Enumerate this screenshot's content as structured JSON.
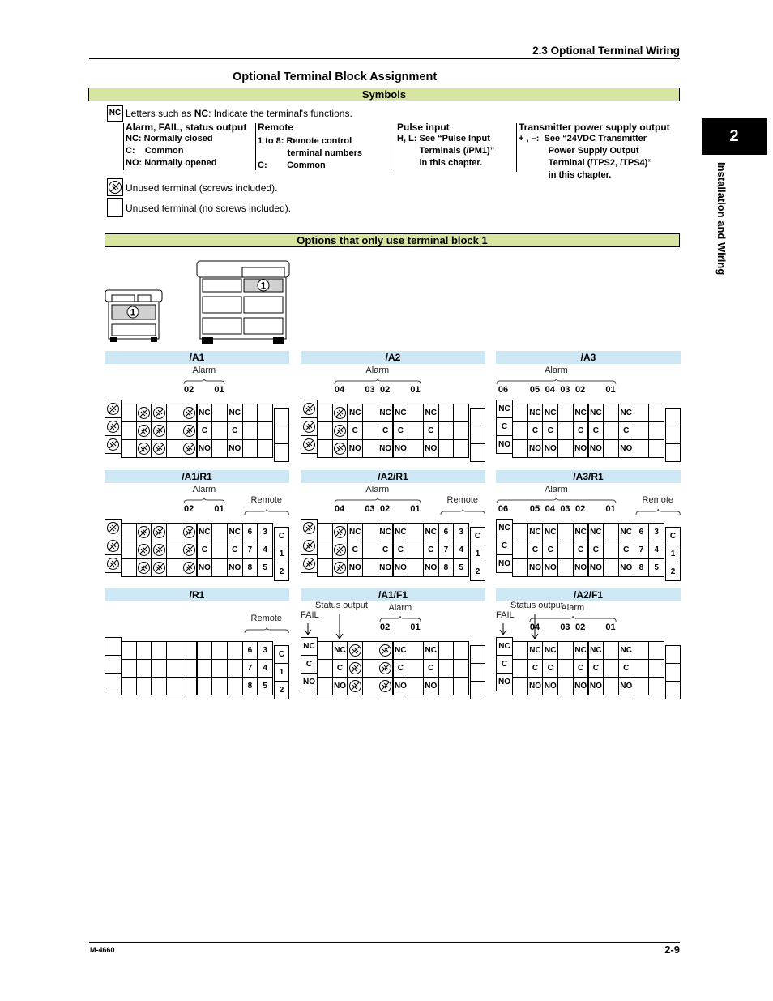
{
  "header": {
    "section_title": "2.3  Optional Terminal Wiring"
  },
  "page_title": "Optional Terminal Block Assignment",
  "symbols": {
    "bar_label": "Symbols",
    "nc_box": "NC",
    "nc_desc_pre": "Letters such as ",
    "nc_desc_bold": "NC",
    "nc_desc_post": ": Indicate the terminal's functions.",
    "legend": [
      {
        "heading": "Alarm, FAIL, status output",
        "lines": [
          "NC: Normally closed",
          "C:    Common",
          "NO: Normally opened"
        ]
      },
      {
        "heading": "Remote",
        "lines": [
          "1 to 8: Remote control",
          "            terminal numbers",
          "C:        Common"
        ]
      },
      {
        "heading": "Pulse input",
        "lines": [
          "H, L: See “Pulse Input",
          "         Terminals (/PM1)”",
          "         in this chapter."
        ]
      },
      {
        "heading": "Transmitter power supply output",
        "lines": [
          "+ , –:  See “24VDC Transmitter",
          "            Power Supply Output",
          "            Terminal (/TPS2, /TPS4)”",
          "            in this chapter."
        ]
      }
    ],
    "unused_screw": "Unused terminal (screws included).",
    "unused_noscrew": "Unused terminal (no screws included)."
  },
  "options_bar": "Options that only use terminal block 1",
  "device_marker": "1",
  "chapter": {
    "number": "2",
    "title": "Installation and Wiring"
  },
  "blocks": [
    {
      "title": "/A1",
      "groups": [
        {
          "label": "Alarm",
          "from": 5,
          "to": 7
        }
      ],
      "numbers": [
        {
          "col": 5,
          "text": "02"
        },
        {
          "col": 7,
          "text": "01"
        }
      ],
      "left": [
        "S",
        "S",
        "S"
      ],
      "main": [
        [
          "",
          "S",
          "S",
          "",
          "S",
          "NC",
          "",
          "NC",
          "",
          ""
        ],
        [
          "",
          "S",
          "S",
          "",
          "S",
          "C",
          "",
          "C",
          "",
          ""
        ],
        [
          "",
          "S",
          "S",
          "",
          "S",
          "NO",
          "",
          "NO",
          "",
          ""
        ]
      ],
      "right": [
        "",
        "",
        ""
      ]
    },
    {
      "title": "/A2",
      "groups": [
        {
          "label": "Alarm",
          "from": 2,
          "to": 7
        }
      ],
      "numbers": [
        {
          "col": 2,
          "text": "04"
        },
        {
          "col": 4,
          "text": "03"
        },
        {
          "col": 5,
          "text": "02"
        },
        {
          "col": 7,
          "text": "01"
        }
      ],
      "left": [
        "S",
        "S",
        "S"
      ],
      "main": [
        [
          "",
          "S",
          "NC",
          "",
          "NC",
          "NC",
          "",
          "NC",
          "",
          ""
        ],
        [
          "",
          "S",
          "C",
          "",
          "C",
          "C",
          "",
          "C",
          "",
          ""
        ],
        [
          "",
          "S",
          "NO",
          "",
          "NO",
          "NO",
          "",
          "NO",
          "",
          ""
        ]
      ],
      "right": [
        "",
        "",
        ""
      ]
    },
    {
      "title": "/A3",
      "groups": [
        {
          "label": "Alarm",
          "from": 0,
          "to": 7
        }
      ],
      "numbers": [
        {
          "col": 0,
          "text": "06"
        },
        {
          "col": 2,
          "text": "05"
        },
        {
          "col": 3,
          "text": "04"
        },
        {
          "col": 4,
          "text": "03"
        },
        {
          "col": 5,
          "text": "02"
        },
        {
          "col": 7,
          "text": "01"
        }
      ],
      "left": [
        "NC",
        "C",
        "NO"
      ],
      "main": [
        [
          "",
          "NC",
          "NC",
          "",
          "NC",
          "NC",
          "",
          "NC",
          "",
          ""
        ],
        [
          "",
          "C",
          "C",
          "",
          "C",
          "C",
          "",
          "C",
          "",
          ""
        ],
        [
          "",
          "NO",
          "NO",
          "",
          "NO",
          "NO",
          "",
          "NO",
          "",
          ""
        ]
      ],
      "right": [
        "",
        "",
        ""
      ]
    },
    {
      "title": "/A1/R1",
      "groups": [
        {
          "label": "Alarm",
          "from": 5,
          "to": 7
        },
        {
          "label": "Remote",
          "from": 8,
          "to": 10
        }
      ],
      "numbers": [
        {
          "col": 5,
          "text": "02"
        },
        {
          "col": 7,
          "text": "01"
        }
      ],
      "left": [
        "S",
        "S",
        "S"
      ],
      "main": [
        [
          "",
          "S",
          "S",
          "",
          "S",
          "NC",
          "",
          "NC",
          "6",
          "3"
        ],
        [
          "",
          "S",
          "S",
          "",
          "S",
          "C",
          "",
          "C",
          "7",
          "4"
        ],
        [
          "",
          "S",
          "S",
          "",
          "S",
          "NO",
          "",
          "NO",
          "8",
          "5"
        ]
      ],
      "right": [
        "C",
        "1",
        "2"
      ]
    },
    {
      "title": "/A2/R1",
      "groups": [
        {
          "label": "Alarm",
          "from": 2,
          "to": 7
        },
        {
          "label": "Remote",
          "from": 8,
          "to": 10
        }
      ],
      "numbers": [
        {
          "col": 2,
          "text": "04"
        },
        {
          "col": 4,
          "text": "03"
        },
        {
          "col": 5,
          "text": "02"
        },
        {
          "col": 7,
          "text": "01"
        }
      ],
      "left": [
        "S",
        "S",
        "S"
      ],
      "main": [
        [
          "",
          "S",
          "NC",
          "",
          "NC",
          "NC",
          "",
          "NC",
          "6",
          "3"
        ],
        [
          "",
          "S",
          "C",
          "",
          "C",
          "C",
          "",
          "C",
          "7",
          "4"
        ],
        [
          "",
          "S",
          "NO",
          "",
          "NO",
          "NO",
          "",
          "NO",
          "8",
          "5"
        ]
      ],
      "right": [
        "C",
        "1",
        "2"
      ]
    },
    {
      "title": "/A3/R1",
      "groups": [
        {
          "label": "Alarm",
          "from": 0,
          "to": 7
        },
        {
          "label": "Remote",
          "from": 8,
          "to": 10
        }
      ],
      "numbers": [
        {
          "col": 0,
          "text": "06"
        },
        {
          "col": 2,
          "text": "05"
        },
        {
          "col": 3,
          "text": "04"
        },
        {
          "col": 4,
          "text": "03"
        },
        {
          "col": 5,
          "text": "02"
        },
        {
          "col": 7,
          "text": "01"
        }
      ],
      "left": [
        "NC",
        "C",
        "NO"
      ],
      "main": [
        [
          "",
          "NC",
          "NC",
          "",
          "NC",
          "NC",
          "",
          "NC",
          "6",
          "3"
        ],
        [
          "",
          "C",
          "C",
          "",
          "C",
          "C",
          "",
          "C",
          "7",
          "4"
        ],
        [
          "",
          "NO",
          "NO",
          "",
          "NO",
          "NO",
          "",
          "NO",
          "8",
          "5"
        ]
      ],
      "right": [
        "C",
        "1",
        "2"
      ]
    },
    {
      "title": "/R1",
      "groups": [
        {
          "label": "Remote",
          "from": 8,
          "to": 10
        }
      ],
      "numbers": [],
      "left": [
        "",
        "",
        ""
      ],
      "main": [
        [
          "",
          "",
          "",
          "",
          "",
          "",
          "",
          "",
          "6",
          "3"
        ],
        [
          "",
          "",
          "",
          "",
          "",
          "",
          "",
          "",
          "7",
          "4"
        ],
        [
          "",
          "",
          "",
          "",
          "",
          "",
          "",
          "",
          "8",
          "5"
        ]
      ],
      "right": [
        "C",
        "1",
        "2"
      ]
    },
    {
      "title": "/A1/F1",
      "groups": [
        {
          "label": "Alarm",
          "from": 5,
          "to": 7
        }
      ],
      "numbers": [
        {
          "col": 5,
          "text": "02"
        },
        {
          "col": 7,
          "text": "01"
        }
      ],
      "arrows": [
        {
          "label": "FAIL",
          "col": 0
        },
        {
          "label": "Status output",
          "col": 2
        }
      ],
      "left": [
        "NC",
        "C",
        "NO"
      ],
      "main": [
        [
          "",
          "NC",
          "S",
          "",
          "S",
          "NC",
          "",
          "NC",
          "",
          ""
        ],
        [
          "",
          "C",
          "S",
          "",
          "S",
          "C",
          "",
          "C",
          "",
          ""
        ],
        [
          "",
          "NO",
          "S",
          "",
          "S",
          "NO",
          "",
          "NO",
          "",
          ""
        ]
      ],
      "right": [
        "",
        "",
        ""
      ]
    },
    {
      "title": "/A2/F1",
      "groups": [
        {
          "label": "Alarm",
          "from": 2,
          "to": 7
        }
      ],
      "numbers": [
        {
          "col": 2,
          "text": "04"
        },
        {
          "col": 4,
          "text": "03"
        },
        {
          "col": 5,
          "text": "02"
        },
        {
          "col": 7,
          "text": "01"
        }
      ],
      "arrows": [
        {
          "label": "FAIL",
          "col": 0
        },
        {
          "label": "Status output",
          "col": 2
        }
      ],
      "left": [
        "NC",
        "C",
        "NO"
      ],
      "main": [
        [
          "",
          "NC",
          "NC",
          "",
          "NC",
          "NC",
          "",
          "NC",
          "",
          ""
        ],
        [
          "",
          "C",
          "C",
          "",
          "C",
          "C",
          "",
          "C",
          "",
          ""
        ],
        [
          "",
          "NO",
          "NO",
          "",
          "NO",
          "NO",
          "",
          "NO",
          "",
          ""
        ]
      ],
      "right": [
        "",
        "",
        ""
      ]
    }
  ],
  "footer": {
    "doc_id": "M-4660",
    "page": "2-9"
  }
}
